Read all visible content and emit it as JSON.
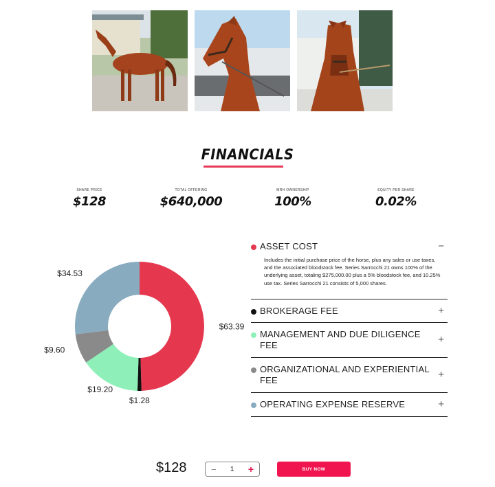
{
  "photos": [
    {
      "alt": "horse-photo-1"
    },
    {
      "alt": "horse-photo-2"
    },
    {
      "alt": "horse-photo-3"
    }
  ],
  "financials": {
    "title": "FINANCIALS",
    "stats": [
      {
        "label": "SHARE PRICE",
        "value": "$128"
      },
      {
        "label": "TOTAL OFFERING",
        "value": "$640,000"
      },
      {
        "label": "MRH OWNERSHIP",
        "value": "100%"
      },
      {
        "label": "EQUITY PER SHARE",
        "value": "0.02%"
      }
    ]
  },
  "chart_data": {
    "type": "pie",
    "categories": [
      "Asset Cost",
      "Brokerage Fee",
      "Management and Due Diligence Fee",
      "Organizational and Experiential Fee",
      "Operating Expense Reserve"
    ],
    "values": [
      63.39,
      1.28,
      19.2,
      9.6,
      34.53
    ],
    "labels": [
      "$63.39",
      "$1.28",
      "$19.20",
      "$9.60",
      "$34.53"
    ],
    "colors": [
      "#e5384f",
      "#111111",
      "#8ef0b8",
      "#8a8a8a",
      "#88abc0"
    ],
    "donut": true
  },
  "accordion": [
    {
      "title": "ASSET COST",
      "color": "#e5384f",
      "toggle": "−",
      "expanded": true,
      "body": "Includes the initial purchase price of the horse, plus any sales or use taxes, and the associated bloodstock fee. Series Sarrocchi 21 owns 100% of the underlying asset, totaling $275,000.00 plus a 5% bloodstock fee, and 10.25% use tax. Series Sarrocchi 21 consists of 5,000 shares."
    },
    {
      "title": "BROKERAGE FEE",
      "color": "#111111",
      "toggle": "+",
      "expanded": false
    },
    {
      "title": "MANAGEMENT AND DUE DILIGENCE FEE",
      "color": "#8ef0b8",
      "toggle": "+",
      "expanded": false
    },
    {
      "title": "ORGANIZATIONAL AND EXPERIENTIAL FEE",
      "color": "#8a8a8a",
      "toggle": "+",
      "expanded": false
    },
    {
      "title": "OPERATING EXPENSE RESERVE",
      "color": "#88abc0",
      "toggle": "+",
      "expanded": false
    }
  ],
  "purchase": {
    "price": "$128",
    "quantity": "1",
    "minus": "−",
    "plus": "+",
    "buy_label": "BUY NOW"
  }
}
